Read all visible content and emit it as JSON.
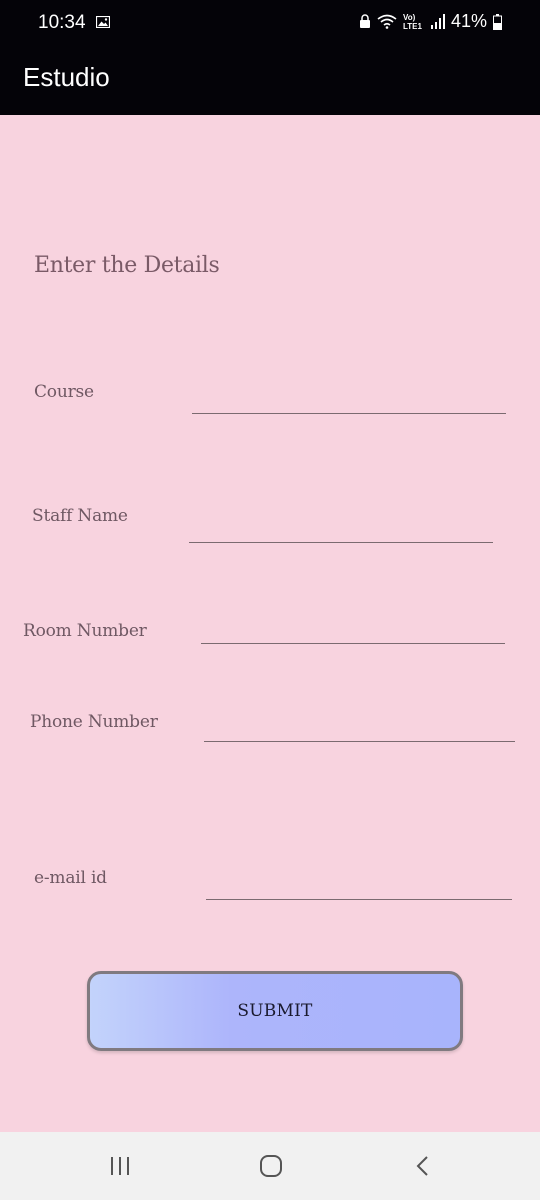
{
  "status_bar": {
    "time": "10:34",
    "battery": "41%",
    "network": "Vo) LTE1"
  },
  "app_bar": {
    "title": "Estudio"
  },
  "form": {
    "heading": "Enter the Details",
    "fields": [
      {
        "label": "Course",
        "value": ""
      },
      {
        "label": "Staff Name",
        "value": ""
      },
      {
        "label": "Room Number",
        "value": ""
      },
      {
        "label": "Phone Number",
        "value": ""
      },
      {
        "label": "e-mail id",
        "value": ""
      }
    ],
    "submit_label": "SUBMIT"
  },
  "colors": {
    "background": "#f8d3df",
    "app_bar": "#040308",
    "button_gradient_start": "#c3d3fb",
    "button_gradient_end": "#a8b4fc"
  },
  "icons": [
    "gallery-icon",
    "lock-icon",
    "wifi-icon",
    "signal-icon",
    "battery-icon",
    "recent-apps-icon",
    "home-icon",
    "back-icon"
  ]
}
